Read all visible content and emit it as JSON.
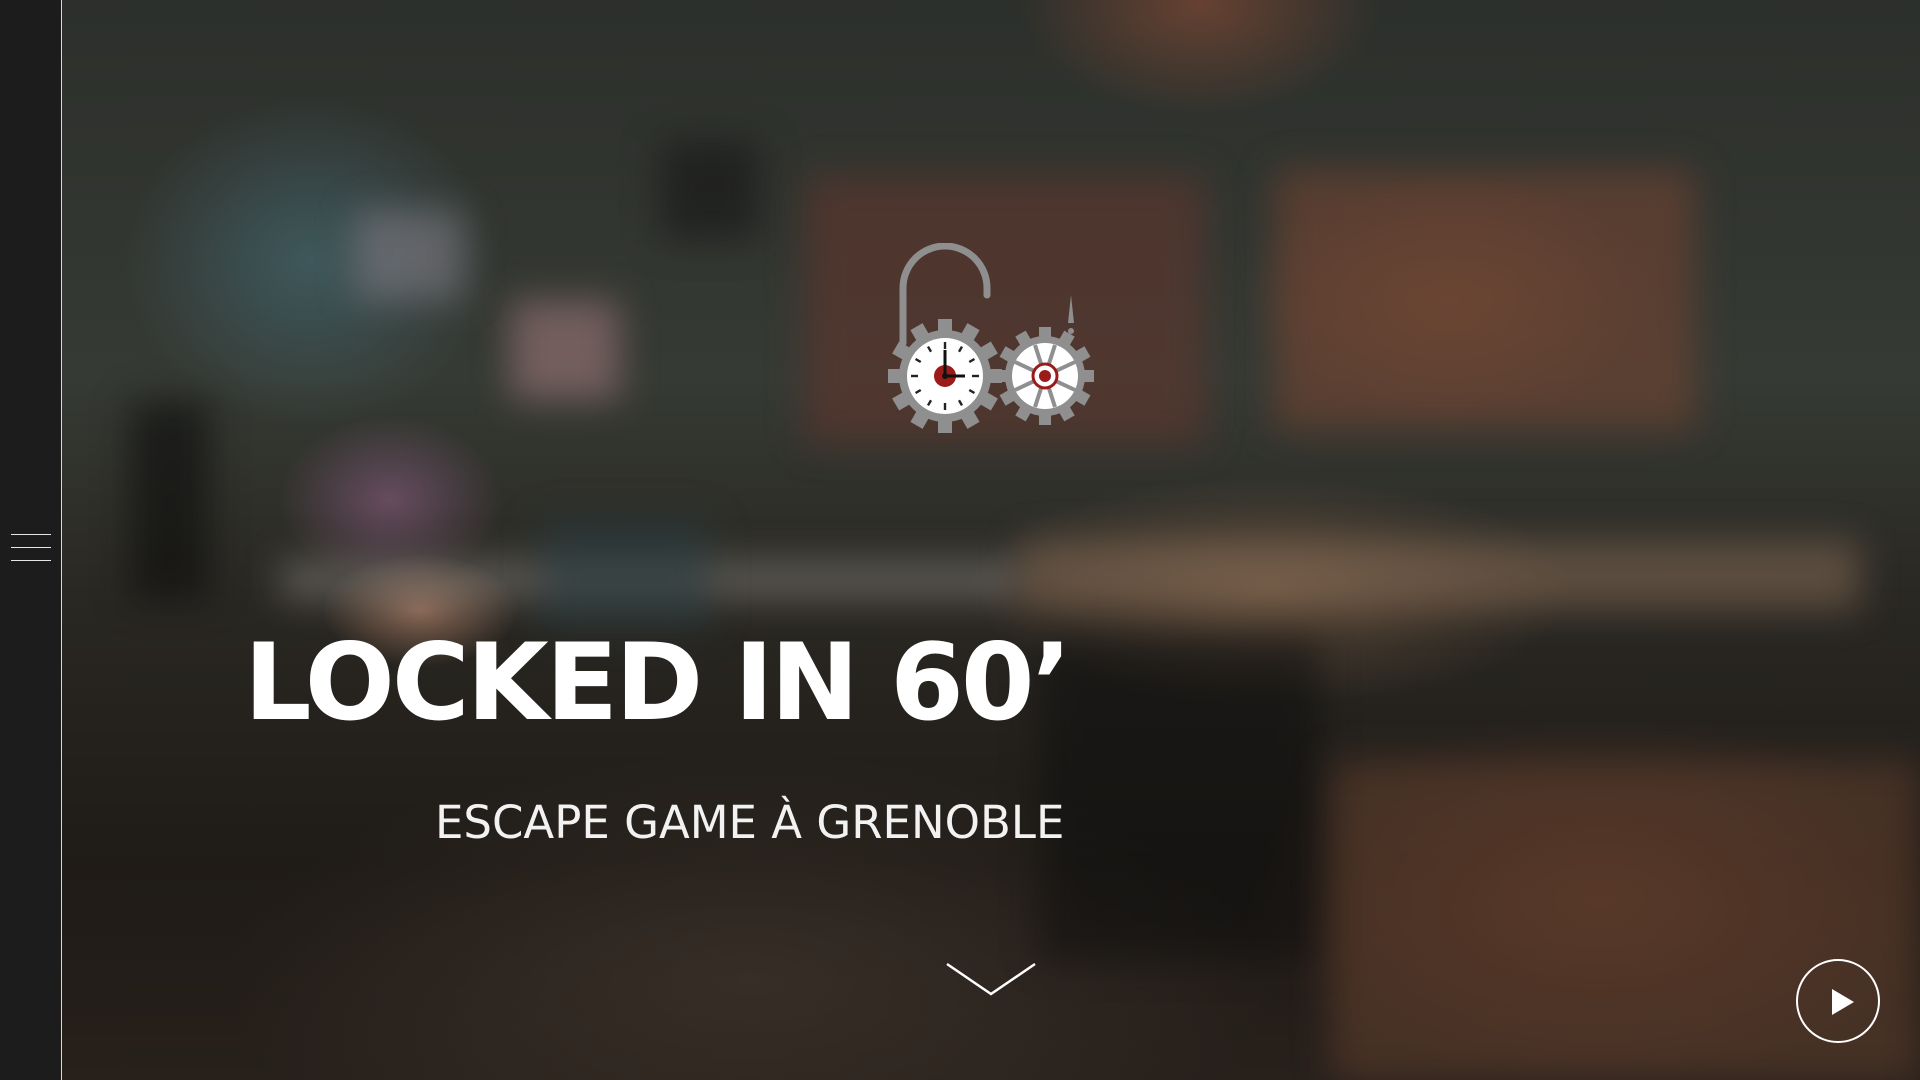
{
  "hero": {
    "title": "LOCKED IN 60’",
    "subtitle": "ESCAPE GAME À GRENOBLE"
  },
  "icons": {
    "menu": "hamburger-menu-icon",
    "logo": "padlock-clock-gears-logo",
    "scroll": "chevron-down-icon",
    "play": "play-icon"
  },
  "colors": {
    "sidebar": "#1c1c1c",
    "text": "#ffffff",
    "logo_grey": "#8f8f8f",
    "logo_red": "#9b1a1a"
  }
}
